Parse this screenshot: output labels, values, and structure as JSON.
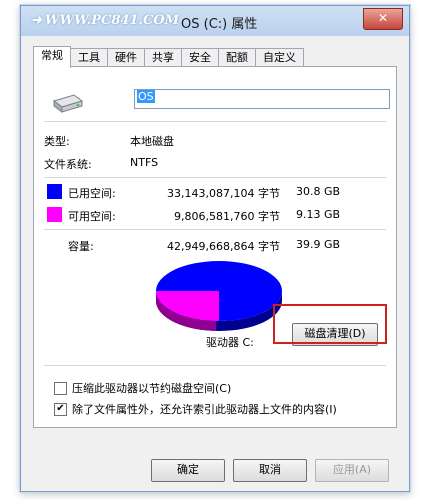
{
  "window": {
    "watermark": "WWW.PC841.COM",
    "title": "OS (C:) 属性",
    "close_glyph": "✕"
  },
  "tabs": [
    "常规",
    "工具",
    "硬件",
    "共享",
    "安全",
    "配额",
    "自定义"
  ],
  "general": {
    "drive_name": "OS",
    "type_label": "类型:",
    "type_value": "本地磁盘",
    "fs_label": "文件系统:",
    "fs_value": "NTFS",
    "used_label": "已用空间:",
    "used_bytes": "33,143,087,104 字节",
    "used_size": "30.8 GB",
    "free_label": "可用空间:",
    "free_bytes": "9,806,581,760 字节",
    "free_size": "9.13 GB",
    "capacity_label": "容量:",
    "capacity_bytes": "42,949,668,864 字节",
    "capacity_size": "39.9 GB",
    "drive_label": "驱动器 C:",
    "cleanup_button": "磁盘清理(D)",
    "compress_option": "压缩此驱动器以节约磁盘空间(C)",
    "compress_checked": false,
    "index_option": "除了文件属性外，还允许索引此驱动器上文件的内容(I)",
    "index_checked": true
  },
  "colors": {
    "used": "#0000ff",
    "free": "#ff00ff"
  },
  "footer": {
    "ok": "确定",
    "cancel": "取消",
    "apply": "应用(A)"
  }
}
